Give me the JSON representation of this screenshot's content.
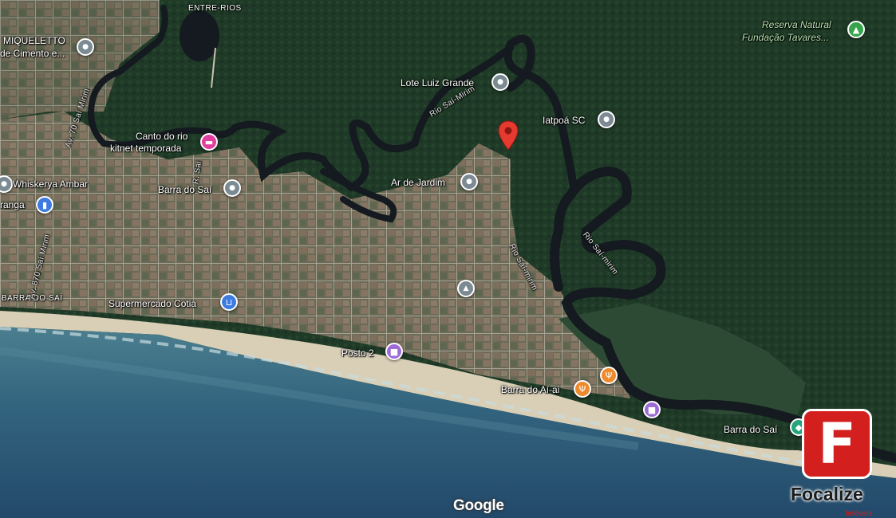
{
  "map": {
    "attribution": "Google",
    "labels": {
      "entre_rios": "ENTRE-RIOS",
      "miquelletto_1": "MIQUELETTO",
      "miquelletto_2": "de Cimento e...",
      "reserva_1": "Reserva Natural",
      "reserva_2": "Fundação Tavares...",
      "lote_luiz_grande": "Lote Luiz Grande",
      "iatpoa": "Iatpoá SC",
      "canto_rio_1": "Canto do rio",
      "canto_rio_2": "kitnet temporada",
      "whiskerya": "Whiskerya Ambar",
      "ranga": "ranga",
      "barra_do_sai_1": "Barra do Saí",
      "ar_de_jardim": "Ar de Jardim",
      "barra_do_sai_caps": "BARRA DO SAÍ",
      "supermercado": "Supermercado Cotia",
      "posto": "Posto 2",
      "barra_do_ahai": "Barra do Aí-ai",
      "barra_do_sai_2": "Barra do Saí",
      "road_sai_mirim_a": "Av. 70 Saí Mirim",
      "road_sai_mirim_b": "Av. 870 Saí Mirim",
      "road_rio_sai_1": "Rio Saí-Mirim",
      "road_rio_sai_2": "Rio Saí-mirim",
      "road_rio_sai_3": "Rio Saí-mirim",
      "road_r_1": "R. Sai",
      "road_r_2": "R."
    }
  },
  "branding": {
    "logo_letter": "F",
    "name": "Focalize",
    "subtitle": "Imóveis"
  },
  "colors": {
    "forest": "#1f3a26",
    "town": "#6b6d5a",
    "beach": "#d9cfb6",
    "ocean": "#3b6f86",
    "river": "#141a1f",
    "brand_red": "#d41f1f"
  }
}
